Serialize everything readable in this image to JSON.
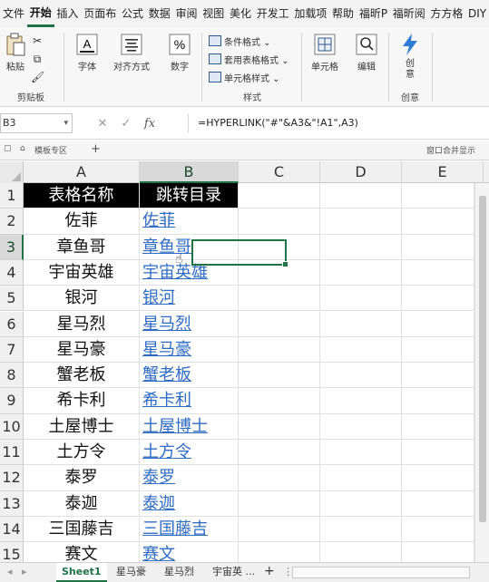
{
  "ribbon": {
    "tabs": [
      "文件",
      "开始",
      "插入",
      "页面布",
      "公式",
      "数据",
      "审阅",
      "视图",
      "美化",
      "开发工",
      "加载项",
      "帮助",
      "福昕P",
      "福昕阅",
      "方方格",
      "DIY"
    ],
    "active_tab": "开始",
    "clipboard": {
      "paste": "粘贴",
      "label": "剪贴板"
    },
    "font": {
      "btn": "字体"
    },
    "alignment": {
      "btn": "对齐方式"
    },
    "number": {
      "btn": "数字"
    },
    "styles": {
      "conditional": "条件格式 ⌄",
      "table": "套用表格格式 ⌄",
      "cell": "单元格样式 ⌄",
      "label": "样式"
    },
    "cells": {
      "btn": "单元格"
    },
    "edit": {
      "btn": "编辑"
    },
    "create": {
      "btn": "创意",
      "label": "创意"
    }
  },
  "formula_bar": {
    "name_box": "B3",
    "formula": "=HYPERLINK(\"#\"&A3&\"!A1\",A3)"
  },
  "workbook_bar": {
    "template_area": "模板专区",
    "add": "+",
    "window_merge": "窗口合并显示"
  },
  "grid": {
    "columns": [
      "A",
      "B",
      "C",
      "D",
      "E"
    ],
    "selected_column": "B",
    "selected_row": "3",
    "header": {
      "a": "表格名称",
      "b": "跳转目录"
    },
    "rows": [
      {
        "num": "1"
      },
      {
        "num": "2",
        "a": "佐菲",
        "b": "佐菲"
      },
      {
        "num": "3",
        "a": "章鱼哥",
        "b": "章鱼哥"
      },
      {
        "num": "4",
        "a": "宇宙英雄",
        "b": "宇宙英雄"
      },
      {
        "num": "5",
        "a": "银河",
        "b": "银河"
      },
      {
        "num": "6",
        "a": "星马烈",
        "b": "星马烈"
      },
      {
        "num": "7",
        "a": "星马豪",
        "b": "星马豪"
      },
      {
        "num": "8",
        "a": "蟹老板",
        "b": "蟹老板"
      },
      {
        "num": "9",
        "a": "希卡利",
        "b": "希卡利"
      },
      {
        "num": "10",
        "a": "土屋博士",
        "b": "土屋博士"
      },
      {
        "num": "11",
        "a": "土方令",
        "b": "土方令"
      },
      {
        "num": "12",
        "a": "泰罗",
        "b": "泰罗"
      },
      {
        "num": "13",
        "a": "泰迦",
        "b": "泰迦"
      },
      {
        "num": "14",
        "a": "三国藤吉",
        "b": "三国藤吉"
      },
      {
        "num": "15",
        "a": "赛文",
        "b": "赛文"
      }
    ]
  },
  "sheets": {
    "tabs": [
      "Sheet1",
      "星马豪",
      "星马烈",
      "宇宙英 ..."
    ],
    "active": "Sheet1",
    "add": "+"
  },
  "colors": {
    "accent": "#217346",
    "link": "#2e6bc4",
    "header_fill": "#000000"
  }
}
